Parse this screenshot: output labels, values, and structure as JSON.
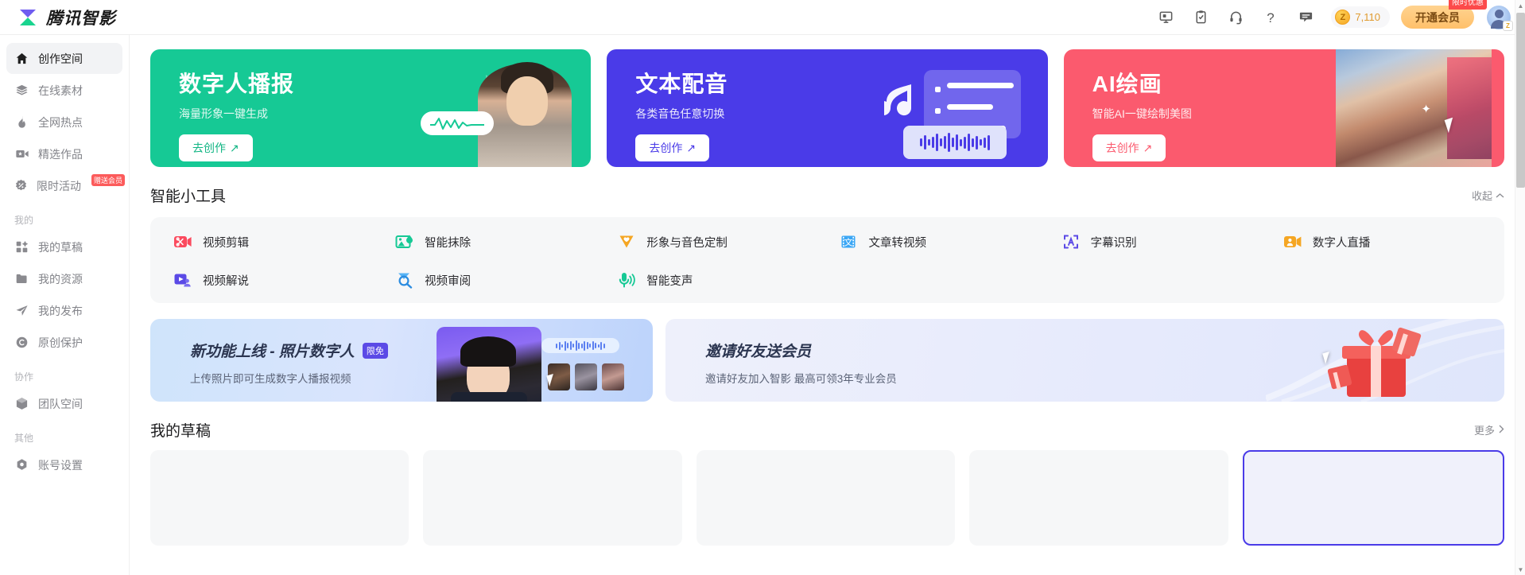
{
  "header": {
    "brand_name": "腾讯智影",
    "logo_icon": "hourglass-logo-icon",
    "icons": [
      {
        "name": "screen-icon",
        "label": "屏幕录制"
      },
      {
        "name": "clipboard-check-icon",
        "label": "任务"
      },
      {
        "name": "headset-icon",
        "label": "客服"
      },
      {
        "name": "question-icon",
        "label": "帮助"
      },
      {
        "name": "message-icon",
        "label": "反馈"
      }
    ],
    "coin": {
      "icon": "coin-icon",
      "symbol": "Z",
      "count": "7,110"
    },
    "vip": {
      "label": "开通会员",
      "badge": "限时优惠"
    },
    "avatar": {
      "name": "user-avatar",
      "tag": "Z"
    }
  },
  "sidebar": {
    "items": [
      {
        "label": "创作空间",
        "icon": "home-icon",
        "active": true
      },
      {
        "label": "在线素材",
        "icon": "layers-icon",
        "active": false
      },
      {
        "label": "全网热点",
        "icon": "fire-icon",
        "active": false
      },
      {
        "label": "精选作品",
        "icon": "video-star-icon",
        "active": false
      },
      {
        "label": "限时活动",
        "icon": "percent-badge-icon",
        "active": false,
        "badge": "赠送会员"
      }
    ],
    "group_mine_title": "我的",
    "mine": [
      {
        "label": "我的草稿",
        "icon": "grid-icon"
      },
      {
        "label": "我的资源",
        "icon": "folder-icon"
      },
      {
        "label": "我的发布",
        "icon": "send-icon"
      },
      {
        "label": "原创保护",
        "icon": "copyright-icon"
      }
    ],
    "group_collab_title": "协作",
    "collab": [
      {
        "label": "团队空间",
        "icon": "box-icon"
      }
    ],
    "group_other_title": "其他",
    "other": [
      {
        "label": "账号设置",
        "icon": "gear-icon"
      }
    ]
  },
  "banners": [
    {
      "title": "数字人播报",
      "subtitle": "海量形象一键生成",
      "button": "去创作",
      "color": "#16c995"
    },
    {
      "title": "文本配音",
      "subtitle": "各类音色任意切换",
      "button": "去创作",
      "color": "#4a3be8"
    },
    {
      "title": "AI绘画",
      "subtitle": "智能AI一键绘制美图",
      "button": "去创作",
      "color": "#fb5a6e"
    }
  ],
  "tools_section": {
    "title": "智能小工具",
    "collapse_label": "收起",
    "collapse_icon": "chevron-up-icon",
    "tools": [
      {
        "label": "视频剪辑",
        "icon": "scissors-video-icon",
        "color": "#fb4a5e"
      },
      {
        "label": "智能抹除",
        "icon": "image-eraser-icon",
        "color": "#16c995"
      },
      {
        "label": "形象与音色定制",
        "icon": "shield-heart-icon",
        "color": "#f5a623"
      },
      {
        "label": "文章转视频",
        "icon": "text-film-icon",
        "color": "#3ba7f5"
      },
      {
        "label": "字幕识别",
        "icon": "subtitle-a-icon",
        "color": "#5b4ae6"
      },
      {
        "label": "数字人直播",
        "icon": "person-camera-icon",
        "color": "#f5a623"
      },
      {
        "label": "视频解说",
        "icon": "play-person-icon",
        "color": "#5b4ae6"
      },
      {
        "label": "视频审阅",
        "icon": "magnifier-review-icon",
        "color": "#3ba7f5"
      },
      {
        "label": "智能变声",
        "icon": "microphone-icon",
        "color": "#16c995"
      }
    ]
  },
  "promos": [
    {
      "title": "新功能上线 - 照片数字人",
      "badge": "限免",
      "subtitle": "上传照片即可生成数字人播报视频"
    },
    {
      "title": "邀请好友送会员",
      "badge": "",
      "subtitle": "邀请好友加入智影 最高可领3年专业会员"
    }
  ],
  "drafts_section": {
    "title": "我的草稿",
    "more_label": "更多",
    "more_icon": "chevron-right-icon",
    "cards": [
      {
        "selected": false
      },
      {
        "selected": false
      },
      {
        "selected": false
      },
      {
        "selected": false
      },
      {
        "selected": true
      }
    ]
  },
  "scrollbar": {
    "up_icon": "scroll-up-icon",
    "down_icon": "scroll-down-icon"
  }
}
